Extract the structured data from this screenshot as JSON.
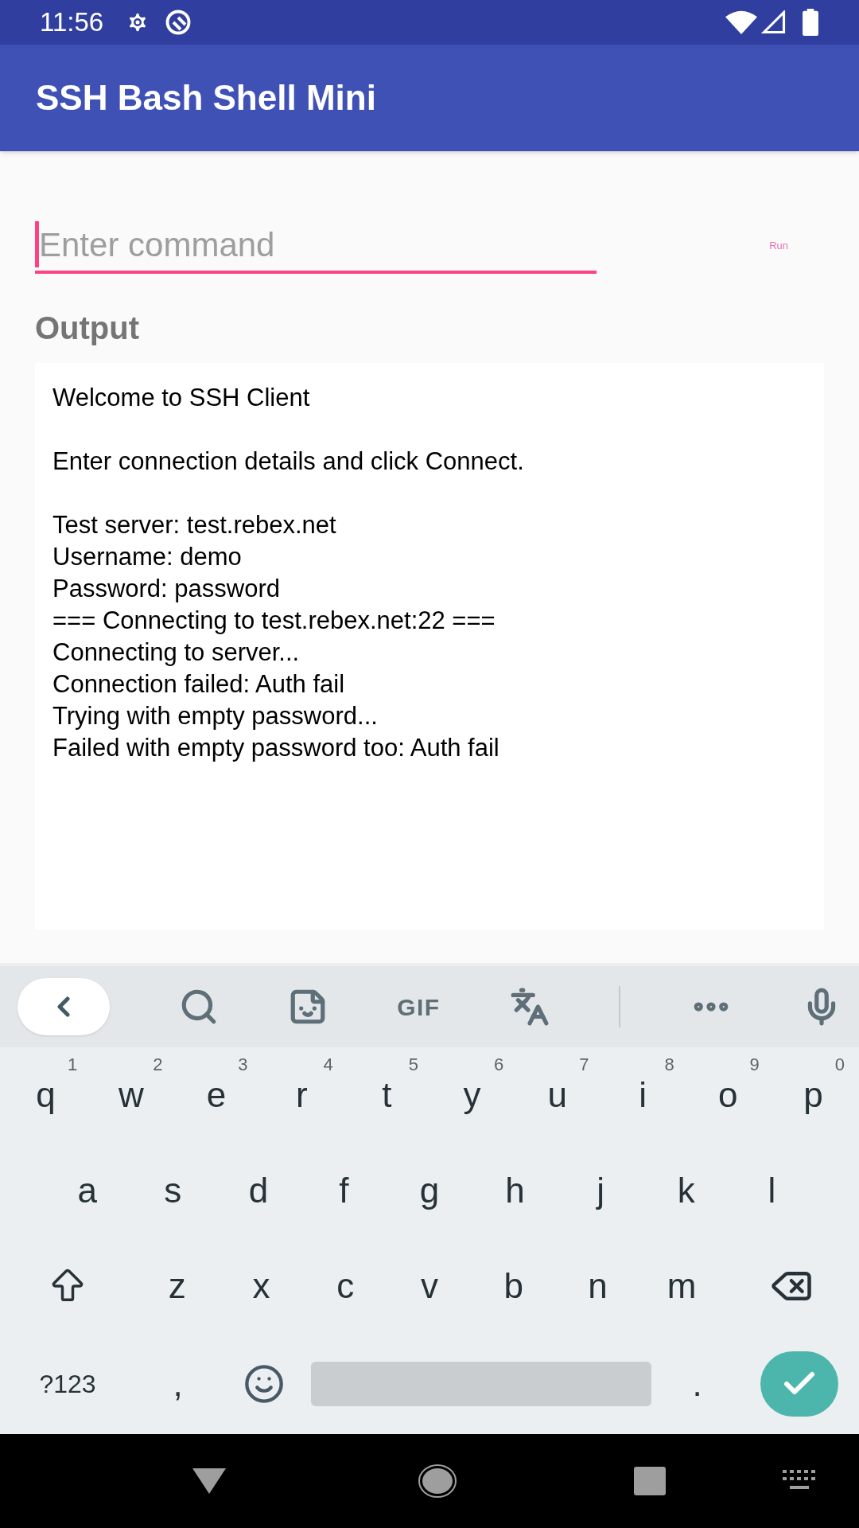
{
  "status_bar": {
    "time": "11:56"
  },
  "app_bar": {
    "title": "SSH Bash Shell Mini"
  },
  "command_field": {
    "placeholder": "Enter command",
    "focused": true
  },
  "run_button": {
    "label": "Run",
    "disabled": true
  },
  "output": {
    "heading": "Output",
    "paragraphs": [
      [
        "Welcome to SSH Client"
      ],
      [
        "Enter connection details and click Connect."
      ],
      [
        "Test server: test.rebex.net",
        "Username: demo",
        "Password: password",
        "=== Connecting to test.rebex.net:22 ===",
        "Connecting to server...",
        "Connection failed: Auth fail",
        "Trying with empty password...",
        "Failed with empty password too: Auth fail"
      ]
    ]
  },
  "keyboard": {
    "toolbar": [
      {
        "kind": "back"
      },
      {
        "kind": "search"
      },
      {
        "kind": "sticker"
      },
      {
        "kind": "gif",
        "label": "GIF"
      },
      {
        "kind": "translate"
      },
      {
        "kind": "divider"
      },
      {
        "kind": "more"
      },
      {
        "kind": "mic"
      }
    ],
    "rows": [
      [
        {
          "kind": "letter",
          "label": "q",
          "hint": "1"
        },
        {
          "kind": "letter",
          "label": "w",
          "hint": "2"
        },
        {
          "kind": "letter",
          "label": "e",
          "hint": "3"
        },
        {
          "kind": "letter",
          "label": "r",
          "hint": "4"
        },
        {
          "kind": "letter",
          "label": "t",
          "hint": "5"
        },
        {
          "kind": "letter",
          "label": "y",
          "hint": "6"
        },
        {
          "kind": "letter",
          "label": "u",
          "hint": "7"
        },
        {
          "kind": "letter",
          "label": "i",
          "hint": "8"
        },
        {
          "kind": "letter",
          "label": "o",
          "hint": "9"
        },
        {
          "kind": "letter",
          "label": "p",
          "hint": "0"
        }
      ],
      [
        {
          "kind": "letter",
          "label": "a"
        },
        {
          "kind": "letter",
          "label": "s"
        },
        {
          "kind": "letter",
          "label": "d"
        },
        {
          "kind": "letter",
          "label": "f"
        },
        {
          "kind": "letter",
          "label": "g"
        },
        {
          "kind": "letter",
          "label": "h"
        },
        {
          "kind": "letter",
          "label": "j"
        },
        {
          "kind": "letter",
          "label": "k"
        },
        {
          "kind": "letter",
          "label": "l"
        }
      ],
      [
        {
          "kind": "shift"
        },
        {
          "kind": "letter",
          "label": "z"
        },
        {
          "kind": "letter",
          "label": "x"
        },
        {
          "kind": "letter",
          "label": "c"
        },
        {
          "kind": "letter",
          "label": "v"
        },
        {
          "kind": "letter",
          "label": "b"
        },
        {
          "kind": "letter",
          "label": "n"
        },
        {
          "kind": "letter",
          "label": "m"
        },
        {
          "kind": "backspace"
        }
      ],
      [
        {
          "kind": "symbols",
          "label": "?123"
        },
        {
          "kind": "letter",
          "label": ","
        },
        {
          "kind": "emoji"
        },
        {
          "kind": "space"
        },
        {
          "kind": "letter",
          "label": "."
        },
        {
          "kind": "enter"
        }
      ]
    ]
  }
}
